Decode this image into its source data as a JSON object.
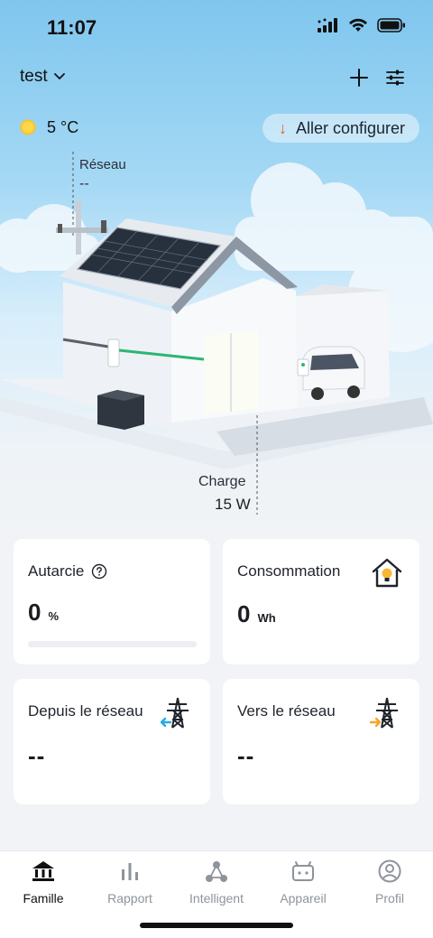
{
  "status_bar": {
    "time": "11:07",
    "icons": [
      "signal-icon",
      "wifi-icon",
      "battery-icon"
    ]
  },
  "header": {
    "home_name": "test",
    "home_dropdown_icon": "chevron-down-icon",
    "add_icon": "plus-icon",
    "settings_icon": "sliders-icon"
  },
  "weather": {
    "icon": "sun-icon",
    "temperature": "5 °C"
  },
  "config_button": {
    "arrow": "↓",
    "label": "Aller configurer"
  },
  "scene": {
    "grid_label": "Réseau",
    "grid_value": "--",
    "charge_label": "Charge",
    "charge_value": "15 W"
  },
  "cards": {
    "autarky": {
      "title": "Autarcie",
      "help_icon": "question-circle-icon",
      "value": "0",
      "unit": "%",
      "progress": 0
    },
    "consumption": {
      "title": "Consommation",
      "icon": "house-bulb-icon",
      "value": "0",
      "unit": "Wh"
    },
    "from_grid": {
      "title": "Depuis le réseau",
      "icon": "pylon-import-icon",
      "value": "--"
    },
    "to_grid": {
      "title": "Vers le réseau",
      "icon": "pylon-export-icon",
      "value": "--"
    }
  },
  "colors": {
    "accent_green": "#2bb673",
    "import_blue": "#27a9e6",
    "export_orange": "#f5a623",
    "alert_red": "#ef5a3c"
  },
  "tabs": [
    {
      "label": "Famille",
      "icon": "home-bank-icon",
      "active": true
    },
    {
      "label": "Rapport",
      "icon": "bar-chart-icon",
      "active": false
    },
    {
      "label": "Intelligent",
      "icon": "nodes-icon",
      "active": false
    },
    {
      "label": "Appareil",
      "icon": "device-icon",
      "active": false
    },
    {
      "label": "Profil",
      "icon": "user-circle-icon",
      "active": false
    }
  ]
}
